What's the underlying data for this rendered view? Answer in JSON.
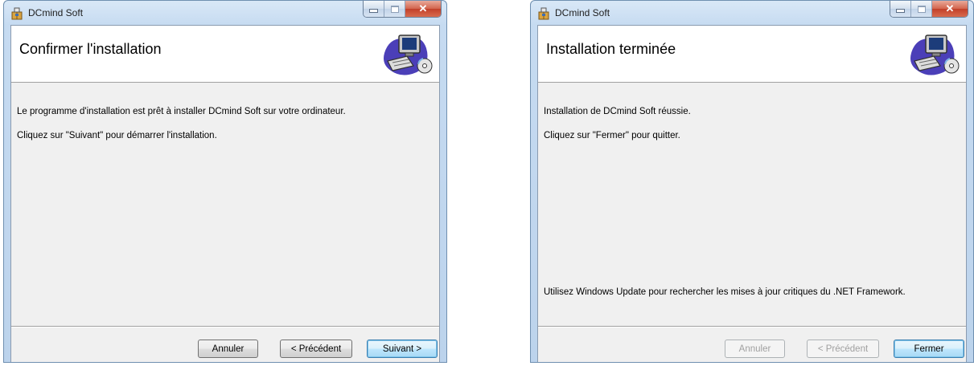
{
  "windows": [
    {
      "title": "DCmind Soft",
      "heading": "Confirmer l'installation",
      "lines": [
        "Le programme d'installation est prêt à installer DCmind Soft sur votre ordinateur.",
        "Cliquez sur \"Suivant\" pour démarrer l'installation."
      ],
      "buttons": [
        "Annuler",
        "< Précédent",
        "Suivant >"
      ]
    },
    {
      "title": "DCmind Soft",
      "heading": "Installation terminée",
      "lines": [
        "Installation de DCmind Soft réussie.",
        "Cliquez sur \"Fermer\" pour quitter."
      ],
      "footer_note": "Utilisez Windows Update pour rechercher les mises à jour critiques du .NET Framework.",
      "buttons": [
        "Annuler",
        "< Précédent",
        "Fermer"
      ]
    }
  ],
  "icons": {
    "app": "installer-icon",
    "banner": "computer-cd-icon",
    "minimize": "minimize-icon",
    "maximize": "maximize-icon",
    "close": "close-icon"
  },
  "colors": {
    "frame": "#c6dbf1",
    "close_button": "#c2402a",
    "default_button_border": "#3c7fb1"
  }
}
